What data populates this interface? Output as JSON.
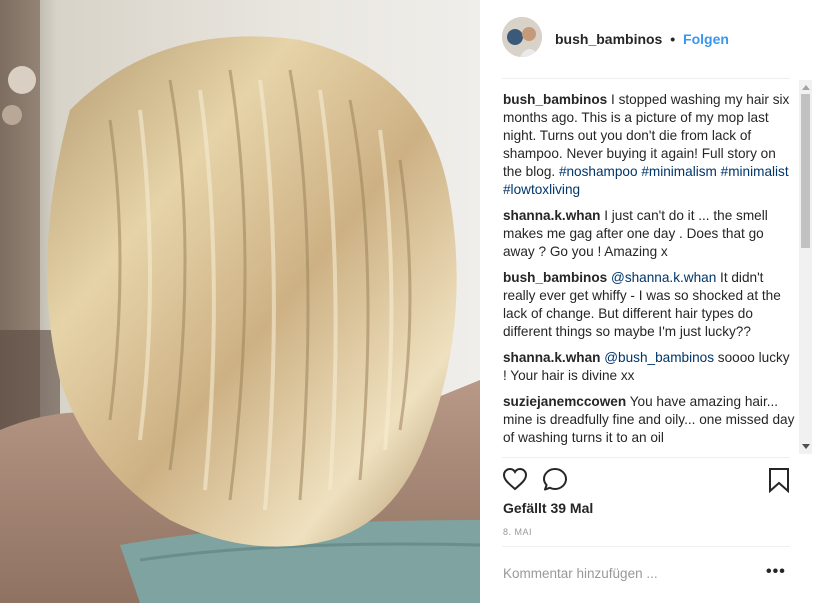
{
  "post": {
    "username": "bush_bambinos",
    "separator": "•",
    "follow_label": "Folgen"
  },
  "caption": {
    "username": "bush_bambinos",
    "text": "I stopped washing my hair six months ago. This is a picture of my mop last night. Turns out you don't die from lack of shampoo. Never buying it again! Full story on the blog.",
    "hashtags": [
      "#noshampoo",
      "#minimalism",
      "#minimalist",
      "#lowtoxliving"
    ]
  },
  "comments": [
    {
      "username": "shanna.k.whan",
      "mention": "",
      "text": "I just can't do it ... the smell makes me gag after one day . Does that go away ? Go you ! Amazing x"
    },
    {
      "username": "bush_bambinos",
      "mention": "@shanna.k.whan",
      "text": "It didn't really ever get whiffy - I was so shocked at the lack of change. But different hair types do different things so maybe I'm just lucky??"
    },
    {
      "username": "shanna.k.whan",
      "mention": "@bush_bambinos",
      "text": "soooo lucky ! Your hair is divine xx"
    },
    {
      "username": "suziejanemccowen",
      "mention": "",
      "text": "You have amazing hair... mine is dreadfully fine and oily... one missed day of washing turns it to an oil"
    }
  ],
  "likes": "Gefällt 39 Mal",
  "date": "8. MAI",
  "comment_box": {
    "placeholder": "Kommentar hinzufügen ..."
  },
  "more_label": "•••",
  "icons": {
    "like": "heart-icon",
    "comment": "comment-icon",
    "save": "bookmark-icon",
    "more": "more-options-icon"
  },
  "colors": {
    "follow": "#3897f0",
    "hashtag": "#003569",
    "text": "#262626",
    "muted": "#999999"
  }
}
